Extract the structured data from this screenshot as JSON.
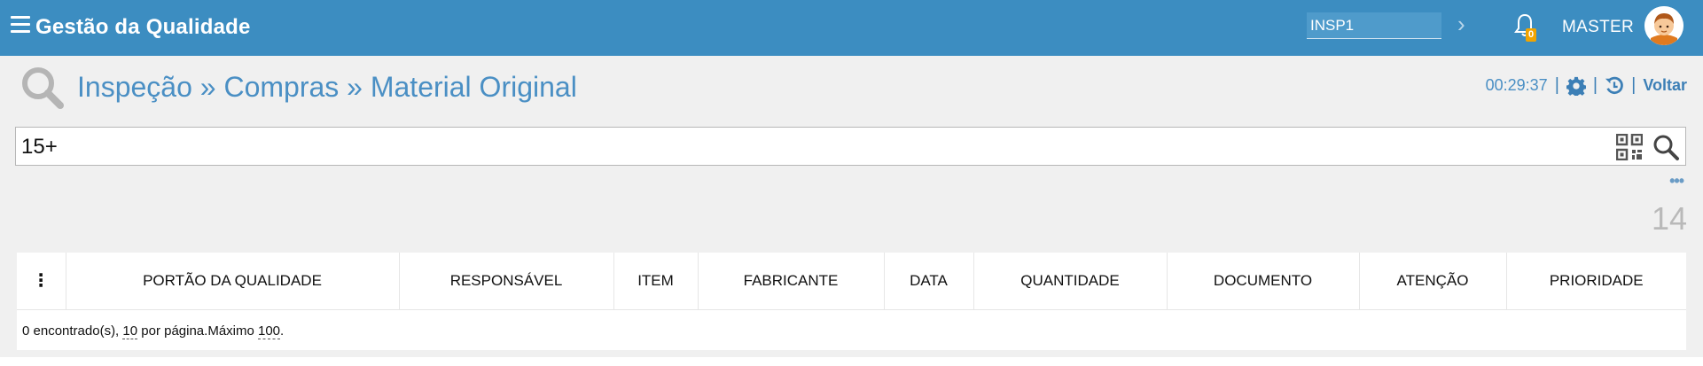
{
  "header": {
    "app_title": "Gestão da Qualidade",
    "insp_value": "INSP1",
    "notifications_count": "0",
    "user_name": "MASTER",
    "brand_color": "#3c8dc1"
  },
  "breadcrumb": {
    "items": [
      "Inspeção",
      "Compras",
      "Material Original"
    ],
    "separator": " » "
  },
  "top_actions": {
    "time": "00:29:37",
    "back_label": "Voltar"
  },
  "search": {
    "value": "15+"
  },
  "results": {
    "count": "14"
  },
  "table": {
    "columns": [
      "PORTÃO DA QUALIDADE",
      "RESPONSÁVEL",
      "ITEM",
      "FABRICANTE",
      "DATA",
      "QUANTIDADE",
      "DOCUMENTO",
      "ATENÇÃO",
      "PRIORIDADE"
    ],
    "footer": {
      "found_text": "0 encontrado(s), ",
      "per_page": "10",
      "per_page_text": " por página.Máximo ",
      "max": "100",
      "end": "."
    }
  },
  "icons": [
    "menu-icon",
    "chevron-right-icon",
    "bell-icon",
    "avatar-icon",
    "magnifier-icon",
    "gear-icon",
    "history-icon",
    "qr-code-icon",
    "search-icon",
    "more-icon",
    "column-menu-icon"
  ]
}
